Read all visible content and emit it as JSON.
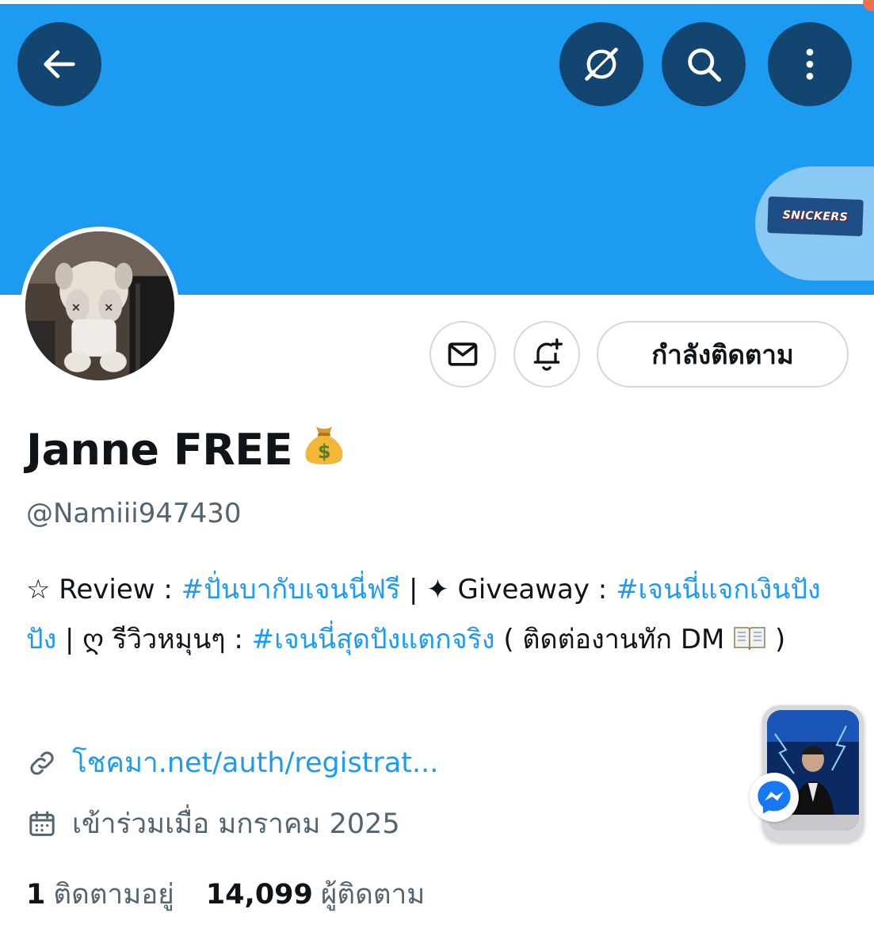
{
  "colors": {
    "banner": "#1d9bf0",
    "accent": "#1d9bf0",
    "text": "#0f1419",
    "muted": "#536471",
    "border": "#cfd9de"
  },
  "header": {
    "back_icon": "arrow-left-icon",
    "grok_icon": "grok-icon",
    "search_icon": "search-icon",
    "more_icon": "more-vertical-icon"
  },
  "banner_image": {
    "label": "SNICKERS"
  },
  "actions": {
    "message_icon": "envelope-icon",
    "notify_icon": "bell-plus-icon",
    "following_label": "กำลังติดตาม"
  },
  "profile": {
    "display_name": "Janne FREE",
    "name_emoji": "money-bag-icon",
    "handle": "@Namiii947430",
    "bio": {
      "p1": "☆ Review : ",
      "tag1": "#ปั่นบากับเจนนี่ฟรี",
      "p2": " | ✦ Giveaway : ",
      "tag2": "#เจนนี่แจกเงินปังปัง",
      "p3": " | ღ รีวิวหมุนๆ : ",
      "tag3": "#เจนนี่สุดปังแตกจริง",
      "p4": " ( ติดต่องานทัก DM ",
      "p5": " )"
    },
    "link": "โชคมา.net/auth/registrat...",
    "joined": "เข้าร่วมเมื่อ มกราคม 2025"
  },
  "stats": {
    "following_count": "1",
    "following_label": "ติดตามอยู่",
    "followers_count": "14,099",
    "followers_label": "ผู้ติดตาม"
  },
  "overlay": {
    "chathead_icon": "messenger-icon"
  }
}
